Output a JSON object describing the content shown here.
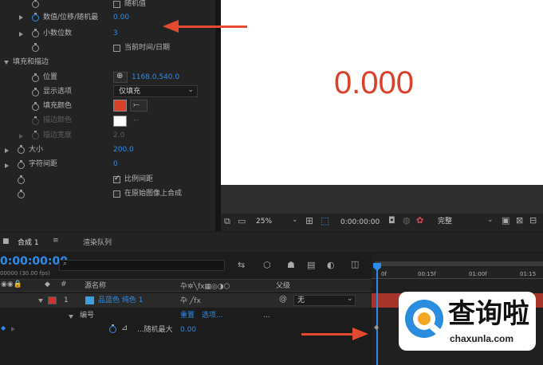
{
  "effects": {
    "random_label": "随机值",
    "value_label": "数值/位移/随机最",
    "value": "0.00",
    "decimals_label": "小数位数",
    "decimals_value": "3",
    "datetime_label": "当前时间/日期",
    "fill_stroke_label": "填充和描边",
    "position_label": "位置",
    "position_value": "1168.0,540.0",
    "display_label": "显示选项",
    "display_value": "仅填充",
    "fill_color_label": "填充颜色",
    "stroke_color_label": "描边颜色",
    "stroke_width_label": "描边宽度",
    "stroke_width_value": "2.0",
    "size_label": "大小",
    "size_value": "200.0",
    "tracking_label": "字符间距",
    "tracking_value": "0",
    "proportional_label": "比例间距",
    "composite_label": "在原始图像上合成",
    "fill_color": "#d9412a",
    "stroke_color": "#ffffff"
  },
  "viewer": {
    "display_text": "0.000",
    "text_color": "#d9412a",
    "zoom": "25%",
    "timecode": "0:00:00:00",
    "quality": "完整"
  },
  "timeline": {
    "comp_tab": "合成 1",
    "render_tab": "渲染队列",
    "timecode": "0:00:00:00",
    "fps": "00000 (30.00 fps)",
    "search_icon": "search-icon",
    "col_source": "源名称",
    "col_parent": "父级",
    "layer_number": "1",
    "layer_name": "品蓝色 纯色 1",
    "layer_color": "#3f9fdd",
    "parent_value": "无",
    "effect_name": "编号",
    "reset": "重置",
    "options": "选项...",
    "ellipsis": "...",
    "property_label": "...随机最大",
    "property_value": "0.00",
    "ruler_marks": [
      "0f",
      "00:15f",
      "01:00f",
      "01:15"
    ]
  },
  "watermark": {
    "cn": "查询啦",
    "url": "chaxunla.com"
  },
  "colors": {
    "annotation_red": "#e34a2f",
    "accent_blue": "#2d8ceb"
  }
}
